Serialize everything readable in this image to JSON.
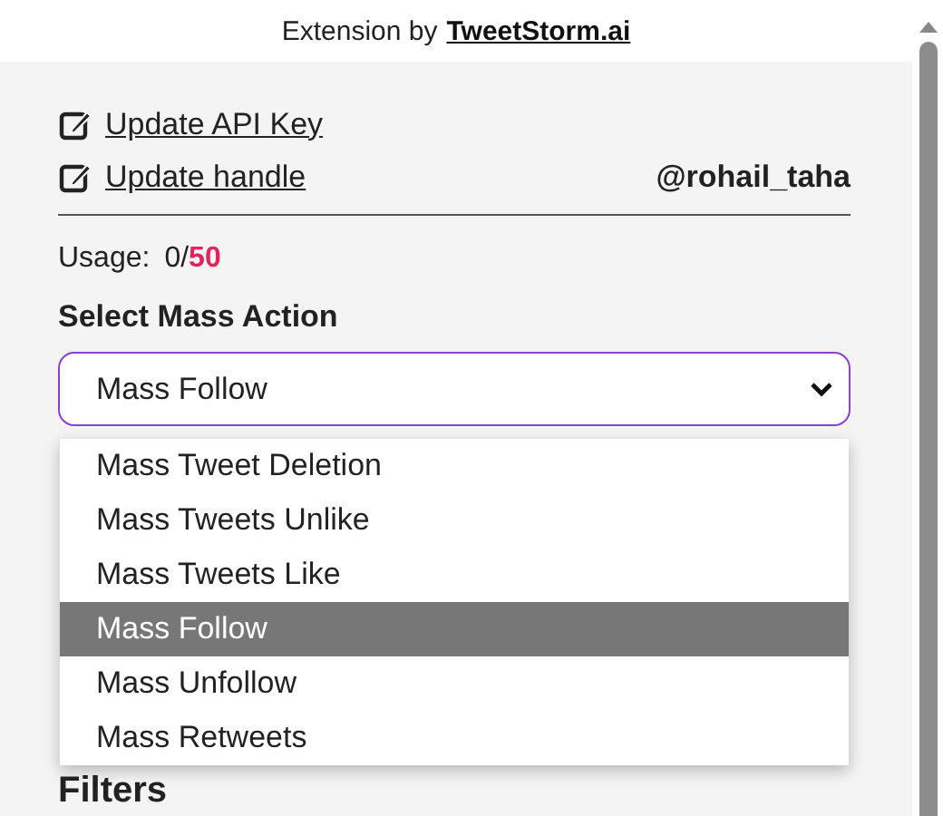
{
  "header": {
    "prefix": "Extension by",
    "link": "TweetStorm.ai"
  },
  "links": [
    {
      "label": "Update API Key"
    },
    {
      "label": "Update handle"
    }
  ],
  "handle": "@rohail_taha",
  "usage": {
    "label": "Usage:",
    "count": "0/",
    "limit": "50"
  },
  "select_heading": "Select Mass Action",
  "select": {
    "value": "Mass Follow",
    "expanded": true
  },
  "options": [
    {
      "label": "Mass Tweet Deletion",
      "selected": false
    },
    {
      "label": "Mass Tweets Unlike",
      "selected": false
    },
    {
      "label": "Mass Tweets Like",
      "selected": false
    },
    {
      "label": "Mass Follow",
      "selected": true
    },
    {
      "label": "Mass Unfollow",
      "selected": false
    },
    {
      "label": "Mass Retweets",
      "selected": false
    }
  ],
  "filters_heading": "Filters"
}
